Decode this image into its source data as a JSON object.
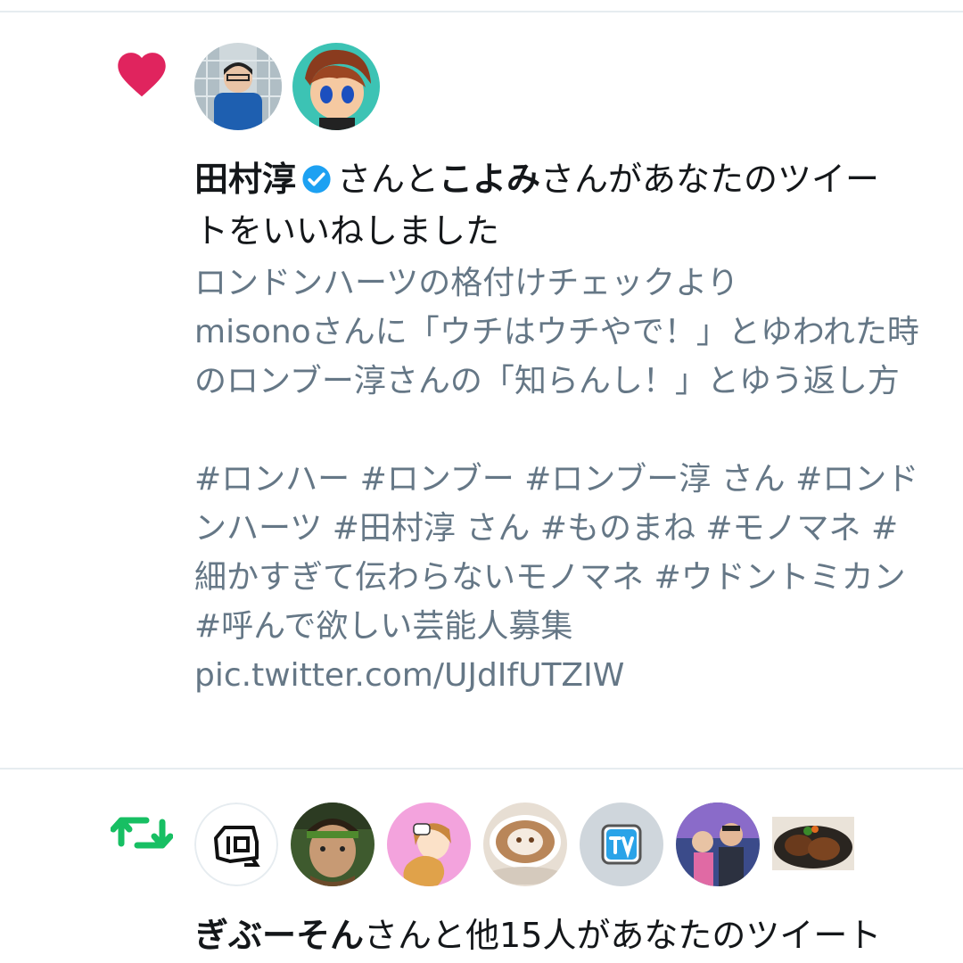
{
  "notifications": [
    {
      "type": "like",
      "icon": "heart-icon",
      "icon_color": "#e0245e",
      "users": [
        {
          "name": "田村淳",
          "verified": true,
          "avatar": "avatar-tamura"
        },
        {
          "name": "こよみ",
          "verified": false,
          "avatar": "avatar-koyomi"
        }
      ],
      "connector": "さんと",
      "suffix": "さんがあなたのツイートをいいねしました",
      "tweet_text": "ロンドンハーツの格付けチェックより\nmisonoさんに「ウチはウチやで！」とゆわれた時のロンブー淳さんの「知らんし！」とゆう返し方\n\n#ロンハー #ロンブー #ロンブー淳 さん #ロンドンハーツ #田村淳 さん #ものまね #モノマネ #細かすぎて伝わらないモノマネ #ウドントミカン #呼んで欲しい芸能人募集\npic.twitter.com/UJdIfUTZIW"
    },
    {
      "type": "retweet",
      "icon": "retweet-icon",
      "icon_color": "#17bf63",
      "users": [
        {
          "name": "ぎぶーそん"
        }
      ],
      "suffix": "さんと他15人があなたのツイート",
      "avatars": [
        "avatar-logo",
        "avatar-warrior",
        "avatar-pink-illustration",
        "avatar-latte-art",
        "avatar-tv",
        "avatar-people",
        "avatar-food"
      ]
    }
  ]
}
